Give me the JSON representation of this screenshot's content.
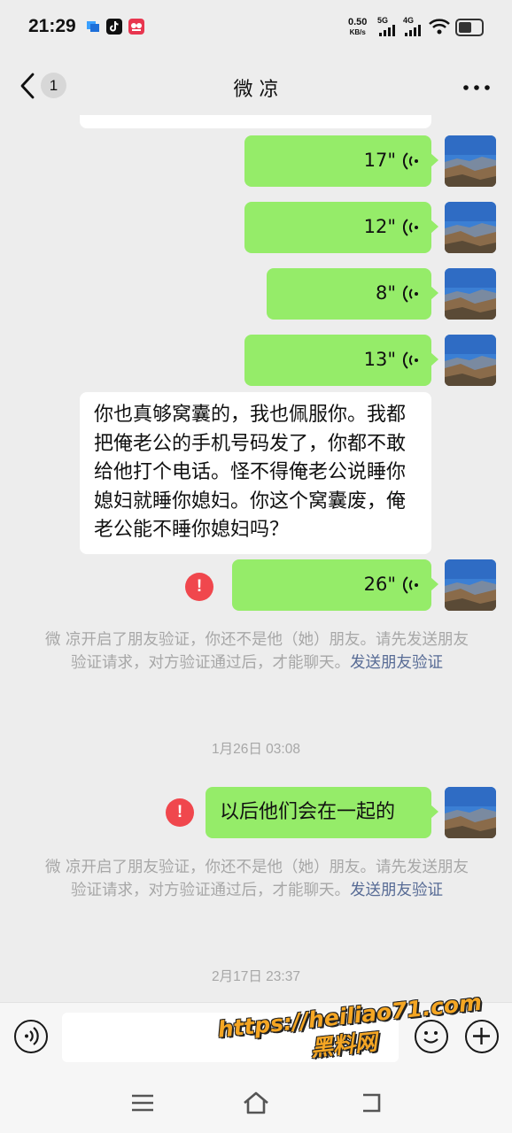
{
  "status_bar": {
    "time": "21:29",
    "net_speed_value": "0.50",
    "net_speed_unit": "KB/s",
    "signal1": "5G",
    "signal2": "4G",
    "app_icons": [
      "notification-app-icon",
      "tiktok-icon",
      "app-icon"
    ]
  },
  "nav": {
    "title": "微 凉",
    "unread_count": "1",
    "icons": [
      "back-chevron-icon",
      "more-dots-icon"
    ]
  },
  "messages": [
    {
      "type": "voice",
      "direction": "out",
      "duration": "17\""
    },
    {
      "type": "voice",
      "direction": "out",
      "duration": "12\""
    },
    {
      "type": "voice",
      "direction": "out",
      "duration": "8\""
    },
    {
      "type": "voice",
      "direction": "out",
      "duration": "13\""
    },
    {
      "type": "text",
      "direction": "in",
      "text": "你也真够窝囊的，我也佩服你。我都把俺老公的手机号码发了，你都不敢给他打个电话。怪不得俺老公说睡你媳妇就睡你媳妇。你这个窝囊废，俺老公能不睡你媳妇吗？"
    },
    {
      "type": "voice",
      "direction": "out",
      "duration": "26\"",
      "failed": true,
      "error_mark": "!"
    },
    {
      "type": "text",
      "direction": "out",
      "text": "以后他们会在一起的",
      "failed": true,
      "error_mark": "!"
    }
  ],
  "system_notice": {
    "text": "微 凉开启了朋友验证，你还不是他（她）朋友。请先发送朋友验证请求，对方验证通过后，才能聊天。",
    "link": "发送朋友验证"
  },
  "timestamps": [
    "1月26日 03:08",
    "2月17日 23:37"
  ],
  "input_bar": {
    "value": "",
    "icons": [
      "voice-input-icon",
      "emoji-icon",
      "plus-icon"
    ]
  },
  "system_nav": {
    "icons": [
      "menu-icon",
      "home-icon",
      "back-icon"
    ]
  },
  "watermark": {
    "line1": "https://heiliao71.com",
    "line2": "黑料网"
  },
  "colors": {
    "sent_bubble": "#95ec69",
    "received_bubble": "#ffffff",
    "background": "#ededed",
    "error": "#f0474d",
    "link": "#576b95"
  }
}
